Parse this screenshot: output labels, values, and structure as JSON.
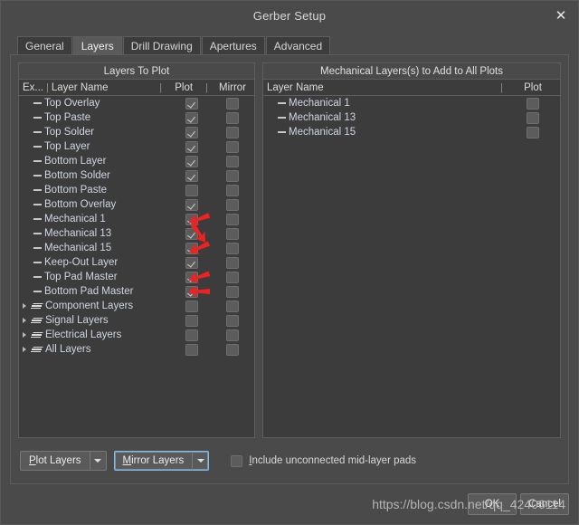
{
  "window": {
    "title": "Gerber Setup",
    "close_icon": "close-icon"
  },
  "tabs": [
    {
      "label": "General",
      "active": false
    },
    {
      "label": "Layers",
      "active": true
    },
    {
      "label": "Drill Drawing",
      "active": false
    },
    {
      "label": "Apertures",
      "active": false
    },
    {
      "label": "Advanced",
      "active": false
    }
  ],
  "left_panel": {
    "title": "Layers To Plot",
    "columns": {
      "extra": "Ex...",
      "layer_name": "Layer Name",
      "plot": "Plot",
      "mirror": "Mirror"
    },
    "rows": [
      {
        "name": "Top Overlay",
        "type": "layer",
        "plot": true,
        "mirror": false,
        "arrow": false
      },
      {
        "name": "Top Paste",
        "type": "layer",
        "plot": true,
        "mirror": false,
        "arrow": false
      },
      {
        "name": "Top Solder",
        "type": "layer",
        "plot": true,
        "mirror": false,
        "arrow": false
      },
      {
        "name": "Top Layer",
        "type": "layer",
        "plot": true,
        "mirror": false,
        "arrow": false
      },
      {
        "name": "Bottom Layer",
        "type": "layer",
        "plot": true,
        "mirror": false,
        "arrow": false
      },
      {
        "name": "Bottom Solder",
        "type": "layer",
        "plot": true,
        "mirror": false,
        "arrow": false
      },
      {
        "name": "Bottom Paste",
        "type": "layer",
        "plot": false,
        "mirror": false,
        "arrow": false
      },
      {
        "name": "Bottom Overlay",
        "type": "layer",
        "plot": true,
        "mirror": false,
        "arrow": false
      },
      {
        "name": "Mechanical 1",
        "type": "layer",
        "plot": true,
        "mirror": false,
        "arrow": true,
        "arrow_angle": -20
      },
      {
        "name": "Mechanical 13",
        "type": "layer",
        "plot": true,
        "mirror": false,
        "arrow": true,
        "arrow_angle": -125
      },
      {
        "name": "Mechanical 15",
        "type": "layer",
        "plot": true,
        "mirror": false,
        "arrow": true,
        "arrow_angle": -25
      },
      {
        "name": "Keep-Out Layer",
        "type": "layer",
        "plot": true,
        "mirror": false,
        "arrow": false
      },
      {
        "name": "Top Pad Master",
        "type": "layer",
        "plot": true,
        "mirror": false,
        "arrow": true,
        "arrow_angle": -18
      },
      {
        "name": "Bottom Pad Master",
        "type": "layer",
        "plot": true,
        "mirror": false,
        "arrow": true,
        "arrow_angle": 0
      },
      {
        "name": "Component Layers",
        "type": "group",
        "plot": false,
        "mirror": false,
        "arrow": false
      },
      {
        "name": "Signal Layers",
        "type": "group",
        "plot": false,
        "mirror": false,
        "arrow": false
      },
      {
        "name": "Electrical Layers",
        "type": "group",
        "plot": false,
        "mirror": false,
        "arrow": false
      },
      {
        "name": "All Layers",
        "type": "group",
        "plot": false,
        "mirror": false,
        "arrow": false
      }
    ]
  },
  "right_panel": {
    "title": "Mechanical Layers(s) to Add to All Plots",
    "columns": {
      "layer_name": "Layer Name",
      "plot": "Plot"
    },
    "rows": [
      {
        "name": "Mechanical 1",
        "type": "layer",
        "plot": false
      },
      {
        "name": "Mechanical 13",
        "type": "layer",
        "plot": false
      },
      {
        "name": "Mechanical 15",
        "type": "layer",
        "plot": false
      }
    ]
  },
  "bottom_controls": {
    "plot_layers_button": {
      "accel": "P",
      "rest": "lot Layers",
      "focused": false
    },
    "mirror_layers_button": {
      "accel": "M",
      "rest": "irror Layers",
      "focused": true
    },
    "include_pads": {
      "accel": "I",
      "rest": "nclude unconnected mid-layer pads",
      "checked": false
    }
  },
  "footer": {
    "ok_label": "OK",
    "cancel_label": "Cancel",
    "watermark": "https://blog.csdn.net/qq_42406114"
  },
  "colors": {
    "window_bg": "#4a4a4a",
    "panel_bg": "#3c3c3c",
    "border": "#5d5d5d",
    "text": "#d8d8d8",
    "layer_text": "#cfd6e2",
    "annotation_red": "#ee2222"
  }
}
